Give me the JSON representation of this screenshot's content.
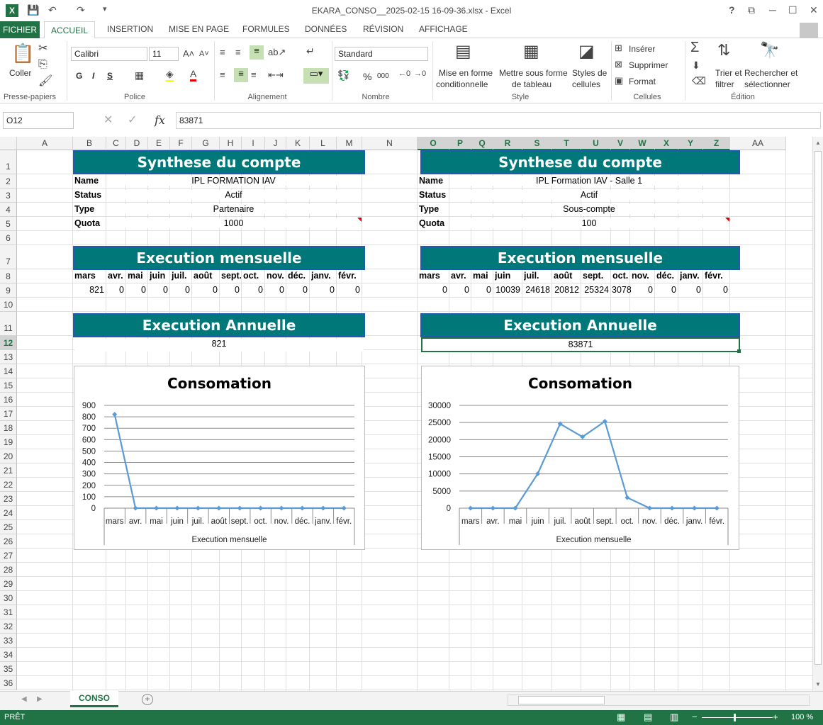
{
  "window": {
    "title": "EKARA_CONSO__2025-02-15 16-09-36.xlsx - Excel",
    "help": "?",
    "minimize": "─",
    "maximize": "☐",
    "close": "✕"
  },
  "tabs": {
    "file": "FICHIER",
    "items": [
      "ACCUEIL",
      "INSERTION",
      "MISE EN PAGE",
      "FORMULES",
      "DONNÉES",
      "RÉVISION",
      "AFFICHAGE"
    ]
  },
  "ribbon": {
    "clipboard": {
      "paste": "Coller",
      "group": "Presse-papiers"
    },
    "font": {
      "name": "Calibri",
      "size": "11",
      "bold": "G",
      "italic": "I",
      "underline": "S",
      "group": "Police"
    },
    "alignment": {
      "group": "Alignement"
    },
    "number": {
      "format": "Standard",
      "percent": "%",
      "thousands": "000",
      "group": "Nombre"
    },
    "style": {
      "conditional": [
        "Mise en forme",
        "conditionnelle"
      ],
      "table": [
        "Mettre sous forme",
        "de tableau"
      ],
      "cellstyles": [
        "Styles de",
        "cellules"
      ],
      "group": "Style"
    },
    "cells": {
      "insert": "Insérer",
      "delete": "Supprimer",
      "format": "Format",
      "group": "Cellules"
    },
    "editing": {
      "sort": [
        "Trier et",
        "filtrer"
      ],
      "find": [
        "Rechercher et",
        "sélectionner"
      ],
      "group": "Édition"
    }
  },
  "formula_bar": {
    "name_box": "O12",
    "fx": "fx",
    "value": "83871"
  },
  "columns": [
    "A",
    "B",
    "C",
    "D",
    "E",
    "F",
    "G",
    "H",
    "I",
    "J",
    "K",
    "L",
    "M",
    "N",
    "O",
    "P",
    "Q",
    "R",
    "S",
    "T",
    "U",
    "V",
    "W",
    "X",
    "Y",
    "Z",
    "AA"
  ],
  "rows": [
    "1",
    "2",
    "3",
    "4",
    "5",
    "6",
    "7",
    "8",
    "9",
    "10",
    "11",
    "12",
    "13",
    "14",
    "15",
    "16",
    "17",
    "18",
    "19",
    "20",
    "21",
    "22",
    "23",
    "24",
    "25",
    "26",
    "27",
    "28",
    "29",
    "30",
    "31",
    "32",
    "33",
    "34",
    "35",
    "36"
  ],
  "left": {
    "synthese_title": "Synthese du compte",
    "labels": [
      "Name",
      "Status",
      "Type",
      "Quota"
    ],
    "values": [
      "IPL FORMATION IAV",
      "Actif",
      "Partenaire",
      "1000"
    ],
    "mensuelle_title": "Execution mensuelle",
    "months": [
      "mars",
      "avr.",
      "mai",
      "juin",
      "juil.",
      "août",
      "sept.",
      "oct.",
      "nov.",
      "déc.",
      "janv.",
      "févr."
    ],
    "month_values": [
      "821",
      "0",
      "0",
      "0",
      "0",
      "0",
      "0",
      "0",
      "0",
      "0",
      "0",
      "0"
    ],
    "annuelle_title": "Execution Annuelle",
    "annuelle_value": "821"
  },
  "right": {
    "synthese_title": "Synthese du compte",
    "labels": [
      "Name",
      "Status",
      "Type",
      "Quota"
    ],
    "values": [
      "IPL Formation IAV - Salle 1",
      "Actif",
      "Sous-compte",
      "100"
    ],
    "mensuelle_title": "Execution mensuelle",
    "months": [
      "mars",
      "avr.",
      "mai",
      "juin",
      "juil.",
      "août",
      "sept.",
      "oct.",
      "nov.",
      "déc.",
      "janv.",
      "févr."
    ],
    "month_values": [
      "0",
      "0",
      "0",
      "10039",
      "24618",
      "20812",
      "25324",
      "3078",
      "0",
      "0",
      "0",
      "0"
    ],
    "annuelle_title": "Execution Annuelle",
    "annuelle_value": "83871"
  },
  "chart_data": [
    {
      "type": "line",
      "title": "Consomation",
      "xlabel": "Execution mensuelle",
      "ylabel": "",
      "categories": [
        "mars",
        "avr.",
        "mai",
        "juin",
        "juil.",
        "août",
        "sept.",
        "oct.",
        "nov.",
        "déc.",
        "janv.",
        "févr."
      ],
      "series": [
        {
          "values": [
            821,
            0,
            0,
            0,
            0,
            0,
            0,
            0,
            0,
            0,
            0,
            0
          ]
        }
      ],
      "ylim": [
        0,
        900
      ],
      "yticks": [
        "0",
        "100",
        "200",
        "300",
        "400",
        "500",
        "600",
        "700",
        "800",
        "900"
      ],
      "grid": true,
      "color": "#5b9bd5"
    },
    {
      "type": "line",
      "title": "Consomation",
      "xlabel": "Execution mensuelle",
      "ylabel": "",
      "categories": [
        "mars",
        "avr.",
        "mai",
        "juin",
        "juil.",
        "août",
        "sept.",
        "oct.",
        "nov.",
        "déc.",
        "janv.",
        "févr."
      ],
      "series": [
        {
          "values": [
            0,
            0,
            0,
            10039,
            24618,
            20812,
            25324,
            3078,
            0,
            0,
            0,
            0
          ]
        }
      ],
      "ylim": [
        0,
        30000
      ],
      "yticks": [
        "0",
        "5000",
        "10000",
        "15000",
        "20000",
        "25000",
        "30000"
      ],
      "grid": true,
      "color": "#5b9bd5"
    }
  ],
  "sheet": {
    "tab": "CONSO",
    "add": "+"
  },
  "status": {
    "ready": "PRÊT",
    "zoom": "100 %"
  }
}
